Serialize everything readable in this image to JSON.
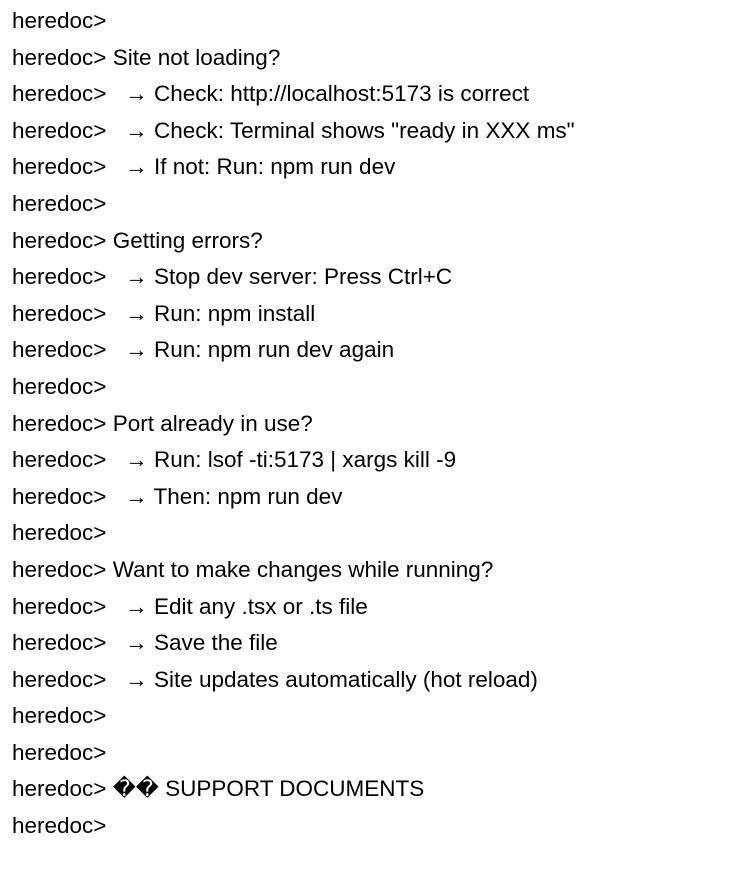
{
  "terminal": {
    "prompt": "heredoc>",
    "lines": [
      "",
      " Site not loading?",
      "   → Check: http://localhost:5173 is correct",
      "   → Check: Terminal shows \"ready in XXX ms\"",
      "   → If not: Run: npm run dev",
      "",
      " Getting errors?",
      "   → Stop dev server: Press Ctrl+C",
      "   → Run: npm install",
      "   → Run: npm run dev again",
      "",
      " Port already in use?",
      "   → Run: lsof -ti:5173 | xargs kill -9",
      "   → Then: npm run dev",
      "",
      " Want to make changes while running?",
      "   → Edit any .tsx or .ts file",
      "   → Save the file",
      "   → Site updates automatically (hot reload)",
      "",
      "",
      " �� SUPPORT DOCUMENTS",
      ""
    ]
  }
}
